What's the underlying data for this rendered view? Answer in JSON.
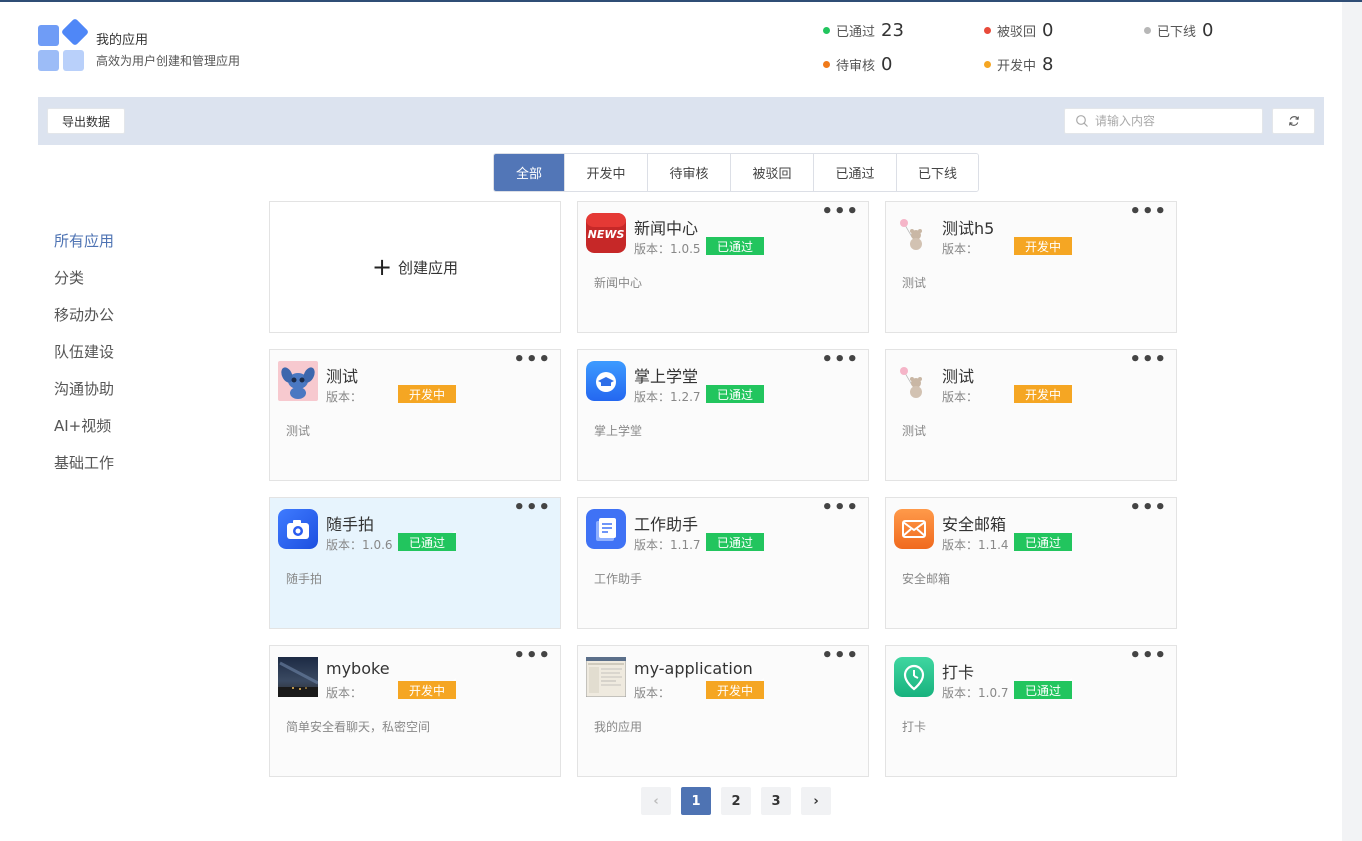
{
  "header": {
    "title": "我的应用",
    "subtitle": "高效为用户创建和管理应用"
  },
  "stats": [
    {
      "label": "已通过",
      "value": "23",
      "color": "#22c55e"
    },
    {
      "label": "被驳回",
      "value": "0",
      "color": "#e84a3a"
    },
    {
      "label": "已下线",
      "value": "0",
      "color": "#b7b7b7"
    },
    {
      "label": "待审核",
      "value": "0",
      "color": "#f07a1a"
    },
    {
      "label": "开发中",
      "value": "8",
      "color": "#f5a623"
    }
  ],
  "toolbar": {
    "export_label": "导出数据",
    "search_placeholder": "请输入内容"
  },
  "tabs": [
    {
      "label": "全部",
      "active": true
    },
    {
      "label": "开发中"
    },
    {
      "label": "待审核"
    },
    {
      "label": "被驳回"
    },
    {
      "label": "已通过"
    },
    {
      "label": "已下线"
    }
  ],
  "sidebar": {
    "items": [
      {
        "label": "所有应用",
        "active": true
      },
      {
        "label": "分类"
      },
      {
        "label": "移动办公"
      },
      {
        "label": "队伍建设"
      },
      {
        "label": "沟通协助"
      },
      {
        "label": "AI+视频"
      },
      {
        "label": "基础工作"
      }
    ]
  },
  "create_card": {
    "plus": "+",
    "label": "创建应用"
  },
  "apps": [
    {
      "name": "新闻中心",
      "version": "版本：1.0.5",
      "status": "已通过",
      "status_type": "pass",
      "desc": "新闻中心",
      "icon": "news-icon"
    },
    {
      "name": "测试h5",
      "version": "版本：",
      "status": "开发中",
      "status_type": "dev",
      "desc": "测试",
      "icon": "bear-balloon-icon"
    },
    {
      "name": "测试",
      "version": "版本：",
      "status": "开发中",
      "status_type": "dev",
      "desc": "测试",
      "icon": "stitch-icon"
    },
    {
      "name": "掌上学堂",
      "version": "版本：1.2.7",
      "status": "已通过",
      "status_type": "pass",
      "desc": "掌上学堂",
      "icon": "graduation-cap-icon"
    },
    {
      "name": "测试",
      "version": "版本：",
      "status": "开发中",
      "status_type": "dev",
      "desc": "测试",
      "icon": "bear-balloon-icon"
    },
    {
      "name": "随手拍",
      "version": "版本：1.0.6",
      "status": "已通过",
      "status_type": "pass",
      "desc": "随手拍",
      "icon": "camera-icon",
      "highlight": true
    },
    {
      "name": "工作助手",
      "version": "版本：1.1.7",
      "status": "已通过",
      "status_type": "pass",
      "desc": "工作助手",
      "icon": "document-icon"
    },
    {
      "name": "安全邮箱",
      "version": "版本：1.1.4",
      "status": "已通过",
      "status_type": "pass",
      "desc": "安全邮箱",
      "icon": "mail-icon"
    },
    {
      "name": "myboke",
      "version": "版本：",
      "status": "开发中",
      "status_type": "dev",
      "desc": "简单安全看聊天，私密空间",
      "icon": "night-sky-icon"
    },
    {
      "name": "my-application",
      "version": "版本：",
      "status": "开发中",
      "status_type": "dev",
      "desc": "我的应用",
      "icon": "screenshot-thumbnail-icon"
    },
    {
      "name": "打卡",
      "version": "版本：1.0.7",
      "status": "已通过",
      "status_type": "pass",
      "desc": "打卡",
      "icon": "location-clock-icon"
    }
  ],
  "more_label": "•••",
  "pagination": {
    "prev": "‹",
    "next": "›",
    "pages": [
      "1",
      "2",
      "3"
    ],
    "current": "1"
  }
}
